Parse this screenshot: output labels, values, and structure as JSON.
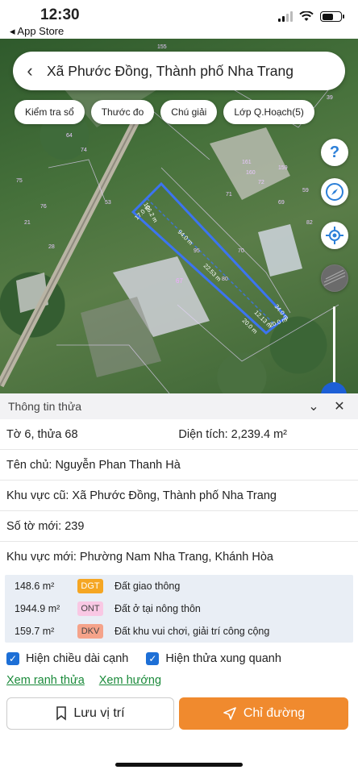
{
  "status": {
    "time": "12:30",
    "back_app": "◂ App Store"
  },
  "map": {
    "search_title": "Xã Phước Đồng, Thành phố Nha Trang",
    "chips": [
      "Kiểm tra sổ",
      "Thước đo",
      "Chú giải",
      "Lớp Q.Hoạch(5)"
    ],
    "fab_help": "?",
    "parcel_number": "67",
    "edge_labels": [
      "22.53 m",
      "94.0 m",
      "17.0 m",
      "106.2 m",
      "20.0 m",
      "20.0 m",
      "34.0 m",
      "12.13 m"
    ],
    "plot_numbers": [
      "155",
      "64",
      "74",
      "75",
      "76",
      "53",
      "161",
      "160",
      "72",
      "159",
      "59",
      "71",
      "69",
      "82",
      "95",
      "70",
      "80",
      "39",
      "45",
      "21",
      "28"
    ],
    "watermark": "batdongsan"
  },
  "sheet": {
    "header": "Thông tin thửa",
    "sheet_info": "Tờ 6, thửa 68",
    "area_label": "Diện tích: 2,239.4 m²",
    "owner": "Tên chủ: Nguyễn Phan Thanh Hà",
    "old_area": "Khu vực cũ: Xã Phước Đồng, Thành phố Nha Trang",
    "new_sheet": "Số tờ mới: 239",
    "new_area": "Khu vực mới: Phường Nam Nha Trang, Khánh Hòa",
    "zones": [
      {
        "area": "148.6 m²",
        "code": "DGT",
        "desc": "Đất giao thông",
        "color": "#f5a623",
        "text_color": "#fff"
      },
      {
        "area": "1944.9 m²",
        "code": "ONT",
        "desc": "Đất ở tại nông thôn",
        "color": "#f9c8e4",
        "text_color": "#444"
      },
      {
        "area": "159.7 m²",
        "code": "DKV",
        "desc": "Đất khu vui chơi, giải trí công cộng",
        "color": "#f5a38a",
        "text_color": "#444"
      }
    ],
    "check_edges": "Hiện chiều dài cạnh",
    "check_neighbors": "Hiện thửa xung quanh",
    "link_boundary": "Xem ranh thửa",
    "link_direction": "Xem hướng",
    "btn_save": "Lưu vị trí",
    "btn_directions": "Chỉ đường"
  }
}
